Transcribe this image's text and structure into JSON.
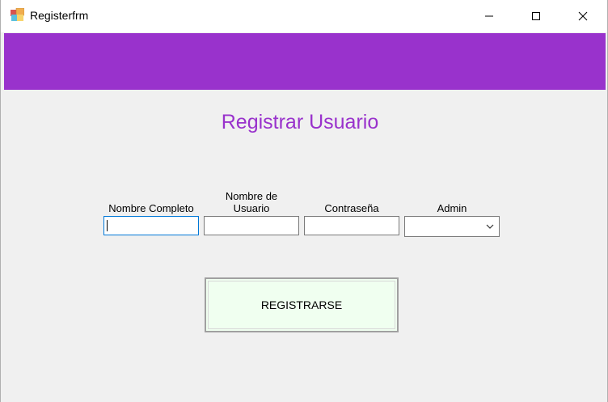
{
  "window": {
    "title": "Registerfrm",
    "icon": "form-icon"
  },
  "caption_buttons": {
    "minimize": "minimize-icon",
    "maximize": "maximize-icon",
    "close": "close-icon"
  },
  "colors": {
    "accent": "#9932cc",
    "button_bg": "#f0fff0",
    "window_bg": "#f0f0f0",
    "focus_border": "#0078d7"
  },
  "form": {
    "title": "Registrar Usuario",
    "fields": {
      "nombre": {
        "label": "Nombre Completo",
        "value": ""
      },
      "usuario": {
        "label_line1": "Nombre de",
        "label_line2": "Usuario",
        "value": ""
      },
      "contrasena": {
        "label": "Contraseña",
        "value": ""
      },
      "admin": {
        "label": "Admin",
        "value": ""
      }
    },
    "submit_label": "REGISTRARSE"
  }
}
